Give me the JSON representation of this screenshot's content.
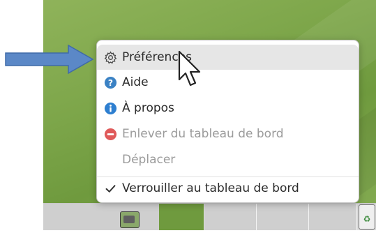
{
  "menu": {
    "items": [
      {
        "label": "Préférences",
        "icon": "gear-icon"
      },
      {
        "label": "Aide",
        "icon": "help-icon"
      },
      {
        "label": "À propos",
        "icon": "info-icon"
      },
      {
        "label": "Enlever du tableau de bord",
        "icon": "remove-icon"
      },
      {
        "label": "Déplacer",
        "icon": ""
      },
      {
        "label": "Verrouiller au tableau de bord",
        "icon": "check-icon"
      }
    ]
  },
  "colors": {
    "help_blue": "#3b82c4",
    "info_blue": "#2e7fd0",
    "remove_red": "#e05a5a",
    "arrow_blue": "#5b88c7",
    "desktop_green": "#7da64a"
  }
}
